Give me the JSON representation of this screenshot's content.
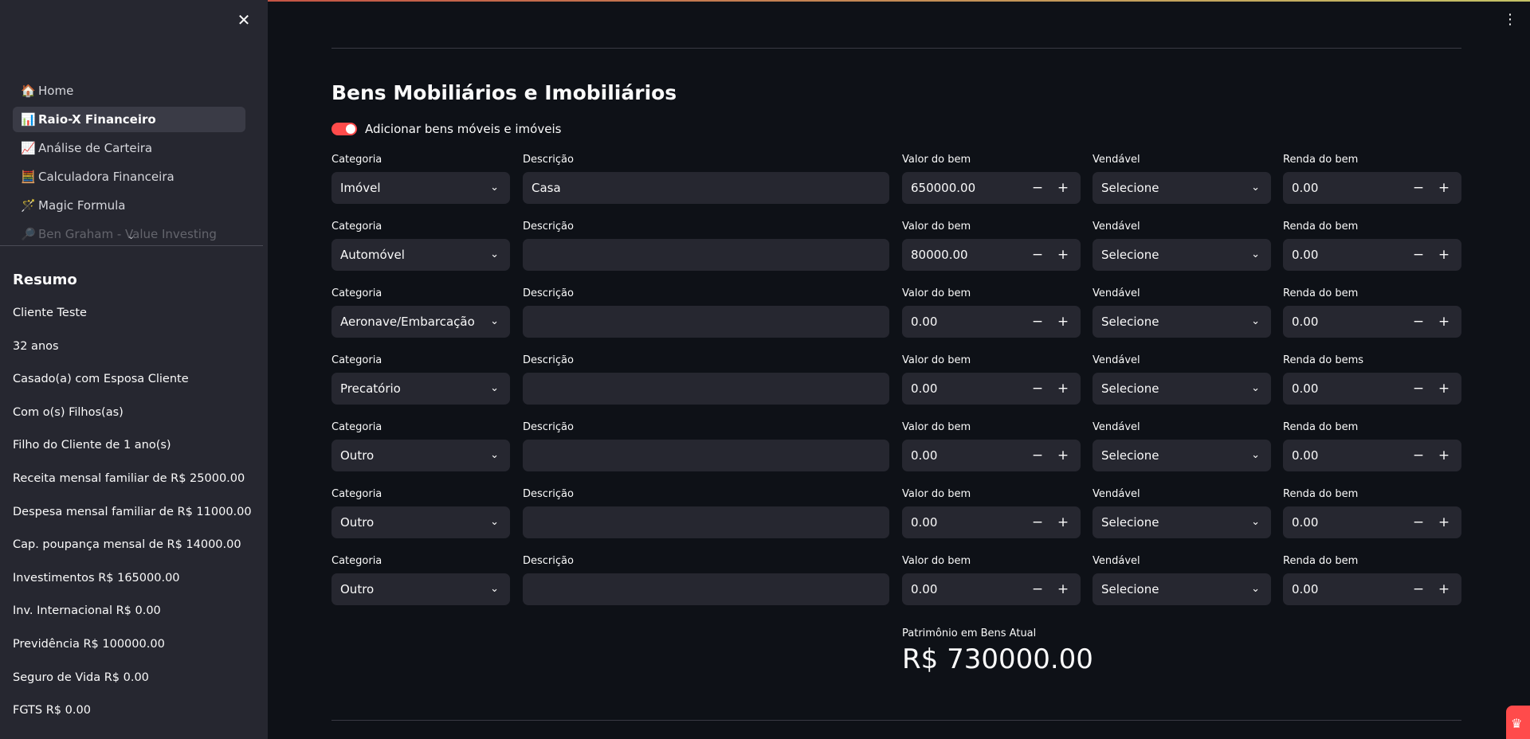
{
  "colors": {
    "accent": "#ff4b4b",
    "background": "#0e1117",
    "sidebar": "#262730",
    "input": "#262730"
  },
  "sidebar": {
    "close_icon": "close-icon",
    "nav": [
      {
        "icon": "🏠",
        "label": "Home",
        "active": false
      },
      {
        "icon": "📊",
        "label": "Raio-X Financeiro",
        "active": true
      },
      {
        "icon": "📈",
        "label": "Análise de Carteira",
        "active": false
      },
      {
        "icon": "🧮",
        "label": "Calculadora Financeira",
        "active": false
      },
      {
        "icon": "🪄",
        "label": "Magic Formula",
        "active": false
      },
      {
        "icon": "🔎",
        "label": "Ben Graham - Value Investing",
        "active": false
      }
    ],
    "resumo_title": "Resumo",
    "resumo_items": [
      "Cliente Teste",
      "32 anos",
      "Casado(a) com Esposa Cliente",
      "Com o(s) Filhos(as)",
      "Filho do Cliente de 1 ano(s)",
      "Receita mensal familiar de R$ 25000.00",
      "Despesa mensal familiar de R$ 11000.00",
      "Cap. poupança mensal de R$ 14000.00",
      "Investimentos R$ 165000.00",
      "Inv. Internacional R$ 0.00",
      "Previdência R$ 100000.00",
      "Seguro de Vida R$ 0.00",
      "FGTS R$ 0.00"
    ]
  },
  "main": {
    "title": "Bens Mobiliários e Imobiliários",
    "toggle_label": "Adicionar bens móveis e imóveis",
    "toggle_on": true,
    "rows": [
      {
        "cat_label": "Categoria",
        "cat": "Imóvel",
        "desc_label": "Descrição",
        "desc": "Casa",
        "val_label": "Valor do bem",
        "val": "650000.00",
        "vend_label": "Vendável",
        "vend": "Selecione",
        "renda_label": "Renda do bem",
        "renda": "0.00"
      },
      {
        "cat_label": "Categoria",
        "cat": "Automóvel",
        "desc_label": "Descrição",
        "desc": "",
        "val_label": "Valor do bem",
        "val": "80000.00",
        "vend_label": "Vendável",
        "vend": "Selecione",
        "renda_label": "Renda do bem",
        "renda": "0.00"
      },
      {
        "cat_label": "Categoria",
        "cat": "Aeronave/Embarcação",
        "desc_label": "Descrição",
        "desc": "",
        "val_label": "Valor do bem",
        "val": "0.00",
        "vend_label": "Vendável",
        "vend": "Selecione",
        "renda_label": "Renda do bem",
        "renda": "0.00"
      },
      {
        "cat_label": "Categoria",
        "cat": "Precatório",
        "desc_label": "Descrição",
        "desc": "",
        "val_label": "Valor do bem",
        "val": "0.00",
        "vend_label": "Vendável",
        "vend": "Selecione",
        "renda_label": "Renda do bems",
        "renda": "0.00"
      },
      {
        "cat_label": "Categoria",
        "cat": "Outro",
        "desc_label": "Descrição",
        "desc": "",
        "val_label": "Valor do bem",
        "val": "0.00",
        "vend_label": "Vendável",
        "vend": "Selecione",
        "renda_label": "Renda do bem",
        "renda": "0.00"
      },
      {
        "cat_label": "Categoria",
        "cat": "Outro",
        "desc_label": "Descrição",
        "desc": "",
        "val_label": "Valor do bem",
        "val": "0.00",
        "vend_label": "Vendável",
        "vend": "Selecione",
        "renda_label": "Renda do bem",
        "renda": "0.00"
      },
      {
        "cat_label": "Categoria",
        "cat": "Outro",
        "desc_label": "Descrição",
        "desc": "",
        "val_label": "Valor do bem",
        "val": "0.00",
        "vend_label": "Vendável",
        "vend": "Selecione",
        "renda_label": "Renda do bem",
        "renda": "0.00"
      }
    ],
    "metric_label": "Patrimônio em Bens Atual",
    "metric_value": "R$ 730000.00",
    "stepper_minus": "−",
    "stepper_plus": "+"
  }
}
